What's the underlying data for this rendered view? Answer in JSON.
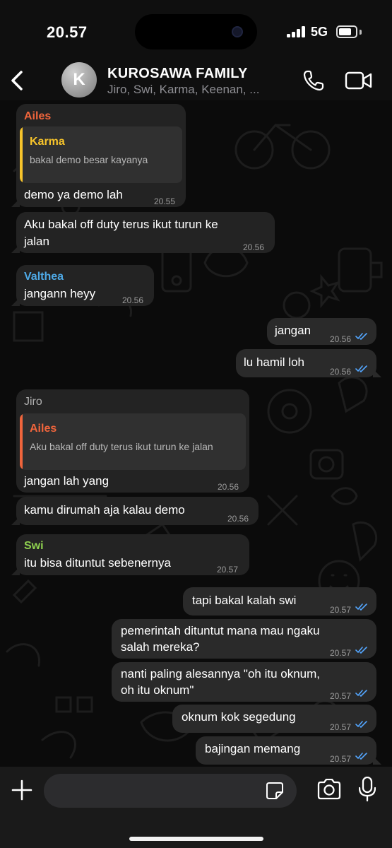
{
  "status_bar": {
    "time": "20.57",
    "network": "5G",
    "battery_level": 0.75,
    "signal_bars": 4
  },
  "header": {
    "avatar_letter": "K",
    "title": "KUROSAWA FAMILY",
    "subtitle": "Jiro, Swi, Karma, Keenan, ...",
    "icons": [
      "back-icon",
      "phone-icon",
      "video-call-icon"
    ]
  },
  "colors": {
    "ailes": "#f0653c",
    "karma": "#f7c42b",
    "valthea": "#4ea9e6",
    "jiro": "#b0b0b0",
    "swi": "#8fd14f",
    "tick": "#53a6ff",
    "bubble_in": "#232323",
    "bubble_out": "#2a2a2a"
  },
  "messages": {
    "m1": {
      "sender": "Ailes",
      "quote_name": "Karma",
      "quote_text": "bakal demo besar kayanya",
      "text": "demo ya demo lah",
      "time": "20.55"
    },
    "m2": {
      "text_line1": "Aku bakal off duty terus ikut turun ke",
      "text_line2": "jalan",
      "time": "20.56"
    },
    "m3": {
      "sender": "Valthea",
      "text": "jangann heyy",
      "time": "20.56"
    },
    "m4": {
      "text": "jangan",
      "time": "20.56"
    },
    "m5": {
      "text": "lu hamil loh",
      "time": "20.56"
    },
    "m6": {
      "sender": "Jiro",
      "quote_name": "Ailes",
      "quote_text": "Aku bakal off duty terus ikut turun ke jalan",
      "text": "jangan lah yang",
      "time": "20.56"
    },
    "m7": {
      "text": "kamu dirumah aja kalau demo",
      "time": "20.56"
    },
    "m8": {
      "sender": "Swi",
      "text": "itu bisa dituntut sebenernya",
      "time": "20.57"
    },
    "m9": {
      "text": "tapi bakal kalah swi",
      "time": "20.57"
    },
    "m10": {
      "text_line1": "pemerintah dituntut mana mau ngaku",
      "text_line2": "salah mereka?",
      "time": "20.57"
    },
    "m11": {
      "text_line1": "nanti paling alesannya \"oh itu oknum,",
      "text_line2": "oh itu oknum\"",
      "time": "20.57"
    },
    "m12": {
      "text": "oknum kok segedung",
      "time": "20.57"
    },
    "m13": {
      "text": "bajingan memang",
      "time": "20.57"
    }
  },
  "input": {
    "placeholder": ""
  }
}
